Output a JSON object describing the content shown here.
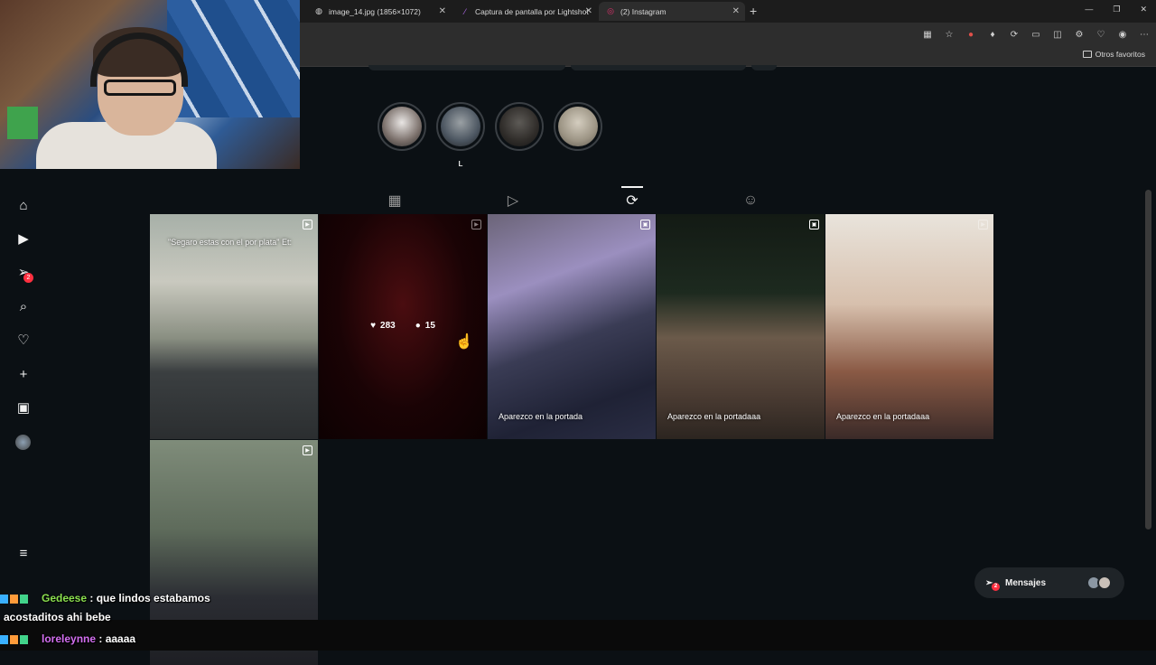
{
  "browser": {
    "tabs": [
      {
        "title": "image_14.jpg (1856×1072)",
        "icon": "globe-icon"
      },
      {
        "title": "Captura de pantalla por Lightshot",
        "icon": "feather-icon"
      },
      {
        "title": "(2) Instagram",
        "icon": "instagram-icon"
      }
    ],
    "favorites_label": "Otros favoritos"
  },
  "sidebar": {
    "items": [
      {
        "name": "home",
        "icon": "home-icon"
      },
      {
        "name": "reels",
        "icon": "reels-icon"
      },
      {
        "name": "messages",
        "icon": "messages-icon",
        "badge": "2"
      },
      {
        "name": "search",
        "icon": "search-icon"
      },
      {
        "name": "notifications",
        "icon": "heart-icon"
      },
      {
        "name": "create",
        "icon": "plus-icon"
      },
      {
        "name": "dashboard",
        "icon": "chart-icon"
      },
      {
        "name": "profile",
        "icon": "avatar"
      }
    ],
    "more_icon": "menu-icon"
  },
  "highlights": [
    {
      "label": ""
    },
    {
      "label": "L"
    },
    {
      "label": ""
    },
    {
      "label": ""
    }
  ],
  "profile_tabs": [
    "posts",
    "reels",
    "reposts",
    "tagged"
  ],
  "posts": [
    {
      "overlay_text": "\"Segaro estas con el por plata\" Et:",
      "caption": ""
    },
    {
      "likes": "283",
      "comments": "15",
      "caption": ""
    },
    {
      "caption": "Aparezco en la portada"
    },
    {
      "caption": "Aparezco en la portadaaa"
    },
    {
      "caption": "Aparezco en la portadaaa"
    },
    {
      "caption": ""
    }
  ],
  "messages_button": {
    "label": "Mensajes",
    "badge": "2"
  },
  "chat": [
    {
      "user": "Gedeese",
      "text": " : que lindos estabamos",
      "text2": "acostaditos ahi bebe"
    },
    {
      "user": "loreleynne",
      "text": " : aaaaa"
    }
  ]
}
